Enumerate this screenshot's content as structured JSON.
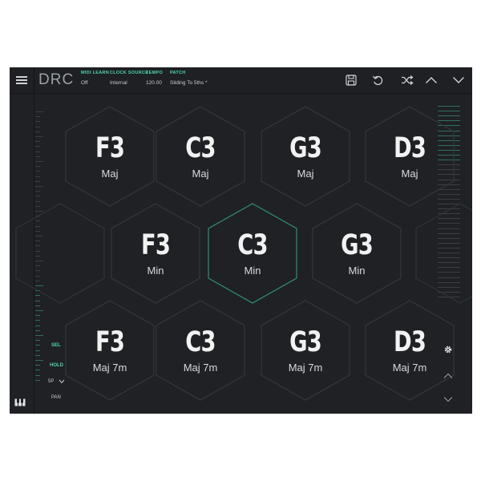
{
  "app": {
    "logo": "DRC",
    "fields": [
      {
        "label": "MIDI LEARN",
        "value": "Off"
      },
      {
        "label": "CLOCK SOURCE",
        "value": "Internal"
      },
      {
        "label": "TEMPO",
        "value": "120.00"
      },
      {
        "label": "PATCH",
        "value": "Sliding To 5ths *"
      }
    ],
    "icons": [
      "save-icon",
      "undo-icon",
      "shuffle-icon",
      "chevron-up-icon",
      "chevron-down-icon"
    ]
  },
  "left_panel": {
    "sel_label": "SEL",
    "hold_label": "HOLD",
    "sp_value": "5P",
    "pan_label": "PAN"
  },
  "colors": {
    "accent": "#4fd6b0",
    "background": "#1f2124",
    "hex_stroke": "#34383b",
    "active_stroke": "#2f8f78"
  },
  "pads": [
    {
      "note": "F3",
      "quality": "Maj",
      "active": false
    },
    {
      "note": "C3",
      "quality": "Maj",
      "active": false
    },
    {
      "note": "G3",
      "quality": "Maj",
      "active": false
    },
    {
      "note": "D3",
      "quality": "Maj",
      "active": false
    },
    {
      "note": "F3",
      "quality": "Min",
      "active": false
    },
    {
      "note": "C3",
      "quality": "Min",
      "active": true
    },
    {
      "note": "G3",
      "quality": "Min",
      "active": false
    },
    {
      "note": "F3",
      "quality": "Maj 7m",
      "active": false
    },
    {
      "note": "C3",
      "quality": "Maj 7m",
      "active": false
    },
    {
      "note": "G3",
      "quality": "Maj 7m",
      "active": false
    },
    {
      "note": "D3",
      "quality": "Maj 7m",
      "active": false
    }
  ]
}
